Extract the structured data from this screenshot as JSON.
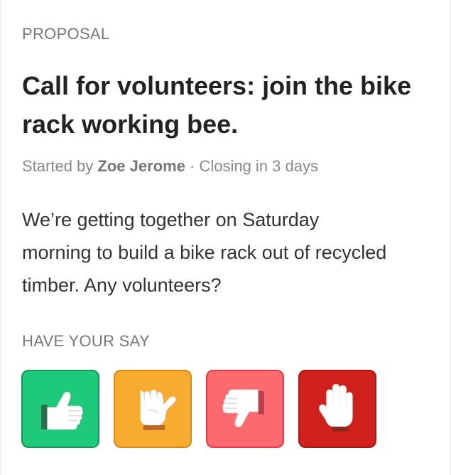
{
  "proposal": {
    "kicker": "PROPOSAL",
    "title": "Call for volunteers: join the bike rack working bee.",
    "meta_prefix": "Started by ",
    "author": "Zoe Jerome",
    "meta_separator": " · ",
    "closing": "Closing in 3 days",
    "body": "We’re getting together on Saturday morning to build a bike rack out of recycled timber. Any volunteers?"
  },
  "vote": {
    "section_label": "HAVE YOUR SAY",
    "options": [
      {
        "name": "agree",
        "icon": "thumbs-up-icon",
        "bg": "#1fc97a",
        "border": "#159556",
        "cuff": "#2e6d4b"
      },
      {
        "name": "abstain",
        "icon": "thumb-sideways-icon",
        "bg": "#f7ab2f",
        "border": "#d4891a",
        "cuff": "#b8692a"
      },
      {
        "name": "disagree",
        "icon": "thumbs-down-icon",
        "bg": "#fb6a6e",
        "border": "#e43a44",
        "cuff": "#b8404a"
      },
      {
        "name": "block",
        "icon": "raised-hand-icon",
        "bg": "#d0211c",
        "border": "#a81814",
        "cuff": "#8a2a1c"
      }
    ]
  }
}
